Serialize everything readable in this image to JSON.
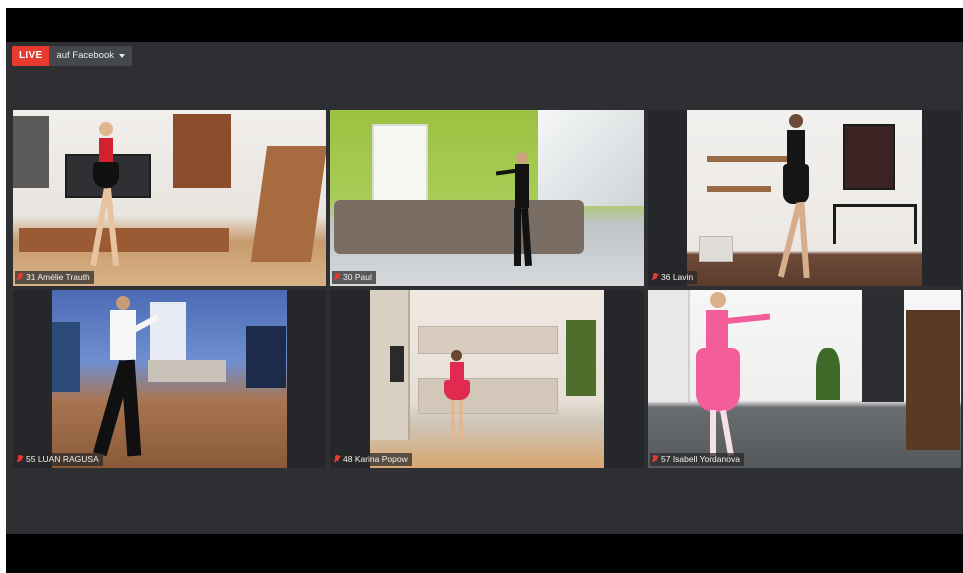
{
  "broadcast": {
    "live_label": "LIVE",
    "destination": "auf Facebook"
  },
  "participants": [
    {
      "name": "31 Amélie Trauth"
    },
    {
      "name": "30 Paul"
    },
    {
      "name": "36 Lavin"
    },
    {
      "name": "55 LUAN RAGUSA"
    },
    {
      "name": "48 Karina Popow"
    },
    {
      "name": "57 Isabell Yordanova"
    }
  ],
  "colors": {
    "live": "#e6392f",
    "app_background": "#2d2f33",
    "muted_mic": "#e6392f"
  },
  "icons": {
    "mic_state": "mic-muted-icon"
  }
}
